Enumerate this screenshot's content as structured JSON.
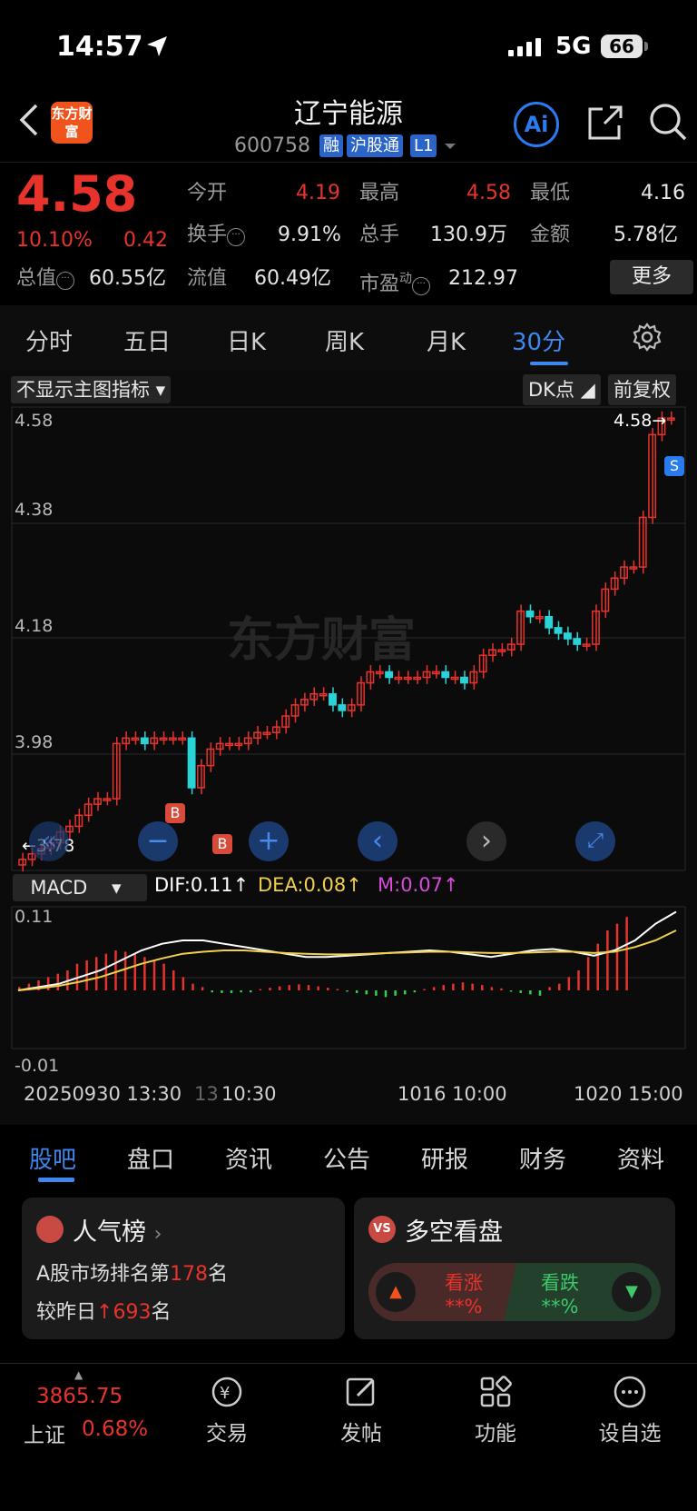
{
  "status_bar": {
    "time": "14:57",
    "network": "5G",
    "battery": "66"
  },
  "header": {
    "logo": "东方财富",
    "title": "辽宁能源",
    "code": "600758",
    "tags": [
      "融",
      "沪股通",
      "L1"
    ],
    "ai_label": "Ai"
  },
  "quote": {
    "price": "4.58",
    "change_pct": "10.10%",
    "change": "0.42",
    "open_label": "今开",
    "open": "4.19",
    "high_label": "最高",
    "high": "4.58",
    "low_label": "最低",
    "low": "4.16",
    "turnover_label": "换手",
    "turnover": "9.91%",
    "volume_label": "总手",
    "volume": "130.9万",
    "amount_label": "金额",
    "amount": "5.78亿",
    "total_cap_label": "总值",
    "total_cap": "60.55亿",
    "float_cap_label": "流值",
    "float_cap": "60.49亿",
    "pe_label": "市盈",
    "pe_sup": "动",
    "pe": "212.97",
    "more_label": "更多"
  },
  "period_tabs": [
    "分时",
    "五日",
    "日K",
    "周K",
    "月K",
    "30分"
  ],
  "active_period": "30分",
  "chart": {
    "indicator_select": "不显示主图指标",
    "dk_label": "DK点",
    "adjust_label": "前复权",
    "watermark": "东方财富",
    "y_labels": [
      "4.58",
      "4.38",
      "4.18",
      "3.98"
    ],
    "high_marker": "4.58",
    "low_marker": "3.78",
    "buy_marker": "B",
    "sell_marker": "S",
    "macd_select": "MACD",
    "dif": "DIF:0.11",
    "dea": "DEA:0.08",
    "m": "M:0.07",
    "macd_top": "0.11",
    "macd_bottom": "-0.01",
    "dates": [
      "20250930 13:30",
      "13",
      "10:30",
      "1016 10:00",
      "1020 15:00"
    ],
    "colors": {
      "up": "#e8332c",
      "down": "#29d3d8",
      "dif": "#ffffff",
      "dea": "#f2d04a",
      "m": "#d84adb"
    }
  },
  "bottom_tabs": [
    "股吧",
    "盘口",
    "资讯",
    "公告",
    "研报",
    "财务",
    "资料"
  ],
  "active_bottom_tab": "股吧",
  "popularity": {
    "title": "人气榜",
    "rank_prefix": "A股市场排名第",
    "rank": "178",
    "rank_suffix": "名",
    "change_prefix": "较昨日",
    "change": "693",
    "change_suffix": "名"
  },
  "sentiment": {
    "title": "多空看盘",
    "bull_label": "看涨",
    "bull_value": "**%",
    "bear_label": "看跌",
    "bear_value": "**%"
  },
  "bottom_nav": {
    "index_value": "3865.75",
    "index_name": "上证",
    "index_change": "0.68%",
    "trade": "交易",
    "post": "发帖",
    "function": "功能",
    "watchlist": "设自选"
  }
}
